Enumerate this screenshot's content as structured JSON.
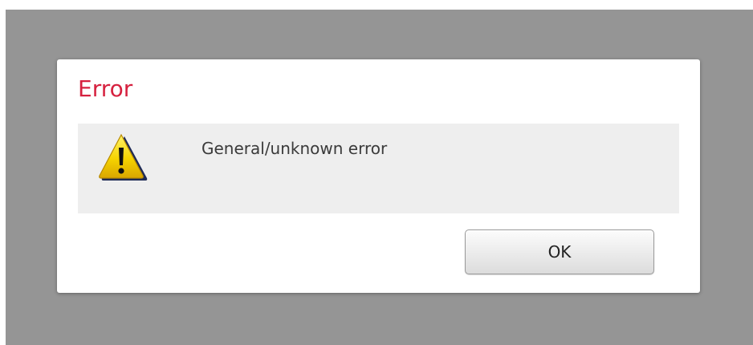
{
  "dialog": {
    "title": "Error",
    "title_color": "#d6213f",
    "message": "General/unknown error",
    "icon": "warning-icon",
    "ok_label": "OK"
  }
}
